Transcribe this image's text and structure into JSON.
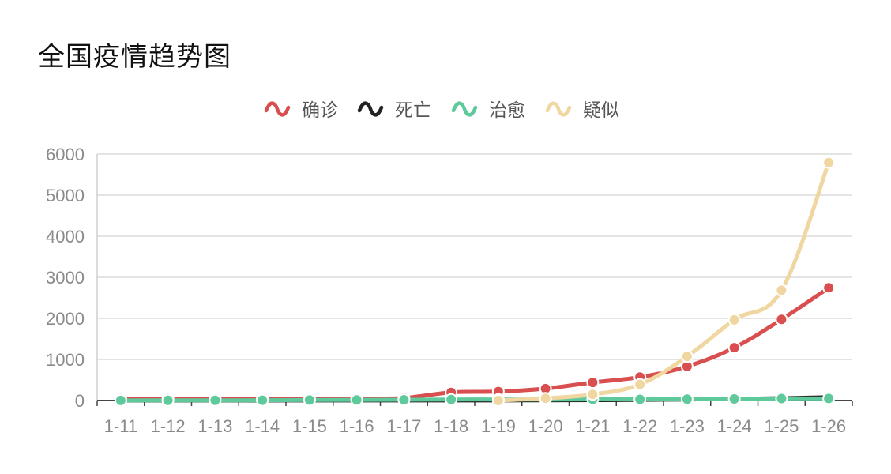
{
  "chart_data": {
    "type": "line",
    "title": "全国疫情趋势图",
    "categories": [
      "1-11",
      "1-12",
      "1-13",
      "1-14",
      "1-15",
      "1-16",
      "1-17",
      "1-18",
      "1-19",
      "1-20",
      "1-21",
      "1-22",
      "1-23",
      "1-24",
      "1-25",
      "1-26"
    ],
    "ylim": [
      0,
      6000
    ],
    "yticks": [
      0,
      1000,
      2000,
      3000,
      4000,
      5000,
      6000
    ],
    "grid": true,
    "legend_position": "top-center",
    "smooth": true,
    "series": [
      {
        "name": "确诊",
        "color": "#d94e4f",
        "values": [
          41,
          41,
          41,
          41,
          41,
          45,
          62,
          198,
          218,
          291,
          440,
          571,
          830,
          1287,
          1975,
          2744
        ],
        "markers": true
      },
      {
        "name": "死亡",
        "color": "#222222",
        "values": [
          1,
          1,
          1,
          1,
          2,
          2,
          2,
          3,
          3,
          6,
          9,
          17,
          25,
          41,
          56,
          80
        ],
        "markers": false
      },
      {
        "name": "治愈",
        "color": "#5ec99a",
        "values": [
          2,
          5,
          5,
          7,
          12,
          15,
          19,
          25,
          25,
          25,
          28,
          28,
          34,
          38,
          49,
          51
        ],
        "markers": true
      },
      {
        "name": "疑似",
        "color": "#f0d6a0",
        "values": [
          null,
          null,
          null,
          null,
          null,
          null,
          null,
          null,
          0,
          54,
          149,
          393,
          1072,
          1965,
          2684,
          5794
        ],
        "markers": true
      }
    ]
  }
}
